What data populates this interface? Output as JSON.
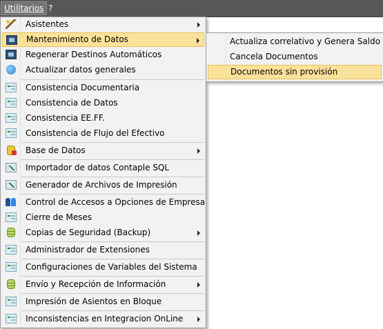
{
  "menubar": {
    "utilitarios": "Utilitarios",
    "help": "?"
  },
  "main_menu": {
    "items": [
      {
        "label": "Asistentes",
        "icon": "wizard-wand-icon",
        "submenu": true
      },
      {
        "label": "Mantenimiento de Datos",
        "icon": "maintenance-icon",
        "submenu": true,
        "highlighted": true
      },
      {
        "label": "Regenerar Destinos Automáticos",
        "icon": "regenerate-icon"
      },
      {
        "label": "Actualizar datos generales",
        "icon": "globe-icon"
      },
      {
        "label": "Consistencia Documentaria",
        "icon": "form-icon"
      },
      {
        "label": "Consistencia de Datos",
        "icon": "form-icon"
      },
      {
        "label": "Consistencia EE.FF.",
        "icon": "form-icon"
      },
      {
        "label": "Consistencia de Flujo del Efectivo",
        "icon": "form-icon"
      },
      {
        "label": "Base de Datos",
        "icon": "database-icon",
        "submenu": true
      },
      {
        "label": "Importador de datos Contaple SQL",
        "icon": "import-chart-icon"
      },
      {
        "label": "Generador de Archivos de Impresión",
        "icon": "print-chart-icon"
      },
      {
        "label": "Control de Accesos a Opciones de Empresa",
        "icon": "users-icon"
      },
      {
        "label": "Cierre de Meses",
        "icon": "form-icon"
      },
      {
        "label": "Copias de Seguridad (Backup)",
        "icon": "backup-db-icon",
        "submenu": true
      },
      {
        "label": "Administrador de Extensiones",
        "icon": "form-icon"
      },
      {
        "label": "Configuraciones de Variables del Sistema",
        "icon": "form-icon"
      },
      {
        "label": "Envío y Recepción de Información",
        "icon": "transfer-db-icon",
        "submenu": true
      },
      {
        "label": "Impresión de Asientos en Bloque",
        "icon": "form-icon"
      },
      {
        "label": "Inconsistencias en Integracion OnLine",
        "icon": "form-icon",
        "submenu": true
      }
    ]
  },
  "sub_menu": {
    "items": [
      {
        "label": "Actualiza correlativo y Genera Saldo"
      },
      {
        "label": "Cancela Documentos"
      },
      {
        "label": "Documentos sin provisión",
        "highlighted": true
      }
    ]
  },
  "colors": {
    "highlight": "#fbe29a",
    "menubar": "#575757",
    "menu_bg": "#f2f2f2"
  }
}
